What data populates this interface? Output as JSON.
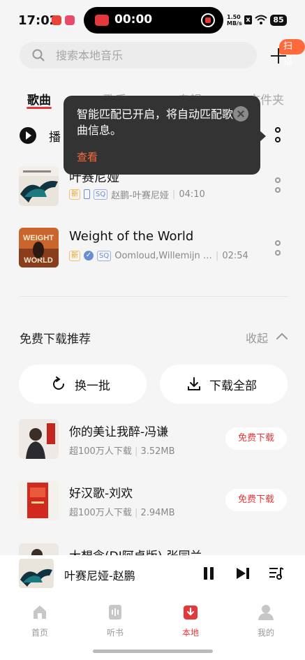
{
  "status_bar": {
    "time": "17:02",
    "recording_time": "00:00",
    "net_speed_value": "1.50",
    "net_speed_unit": "MB/s",
    "battery": "85"
  },
  "search": {
    "placeholder": "搜索本地音乐",
    "scan_badge": "扫描"
  },
  "tabs": [
    {
      "label": "歌曲",
      "active": true
    },
    {
      "label": "歌手",
      "active": false
    },
    {
      "label": "专辑",
      "active": false
    },
    {
      "label": "文件夹",
      "active": false
    }
  ],
  "play_all_label": "播",
  "tooltip": {
    "text": "智能匹配已开启，将自动匹配歌曲信息。",
    "link": "查看"
  },
  "songs": [
    {
      "title": "叶赛尼娅",
      "tag_new": "新",
      "tag_sq": "SQ",
      "artist_album": "赵鹏-叶赛尼娅",
      "duration": "04:10"
    },
    {
      "title": "Weight of the World",
      "tag_new": "新",
      "tag_sq": "SQ",
      "artist_album": "Oomloud,Willemijn …",
      "duration": "02:54"
    }
  ],
  "recommend": {
    "title": "免费下载推荐",
    "collapse": "收起",
    "refresh_label": "换一批",
    "download_all_label": "下载全部",
    "items": [
      {
        "name": "你的美让我醉-冯谦",
        "downloads": "超100万人下载",
        "size": "3.52MB",
        "action": "免费下载"
      },
      {
        "name": "好汉歌-刘欢",
        "downloads": "超100万人下载",
        "size": "2.94MB",
        "action": "免费下载"
      },
      {
        "name": "大想念(DJ阿卓版)-张同兰"
      }
    ]
  },
  "mini_player": {
    "title": "叶赛尼娅-赵鹏"
  },
  "bottom_nav": [
    {
      "label": "首页",
      "icon": "home-icon",
      "active": false
    },
    {
      "label": "听书",
      "icon": "book-icon",
      "active": false
    },
    {
      "label": "本地",
      "icon": "download-icon",
      "active": true
    },
    {
      "label": "我的",
      "icon": "user-icon",
      "active": false
    }
  ],
  "colors": {
    "accent": "#e5383b",
    "badge": "#ff6a3d",
    "background": "#f5f5f5"
  }
}
